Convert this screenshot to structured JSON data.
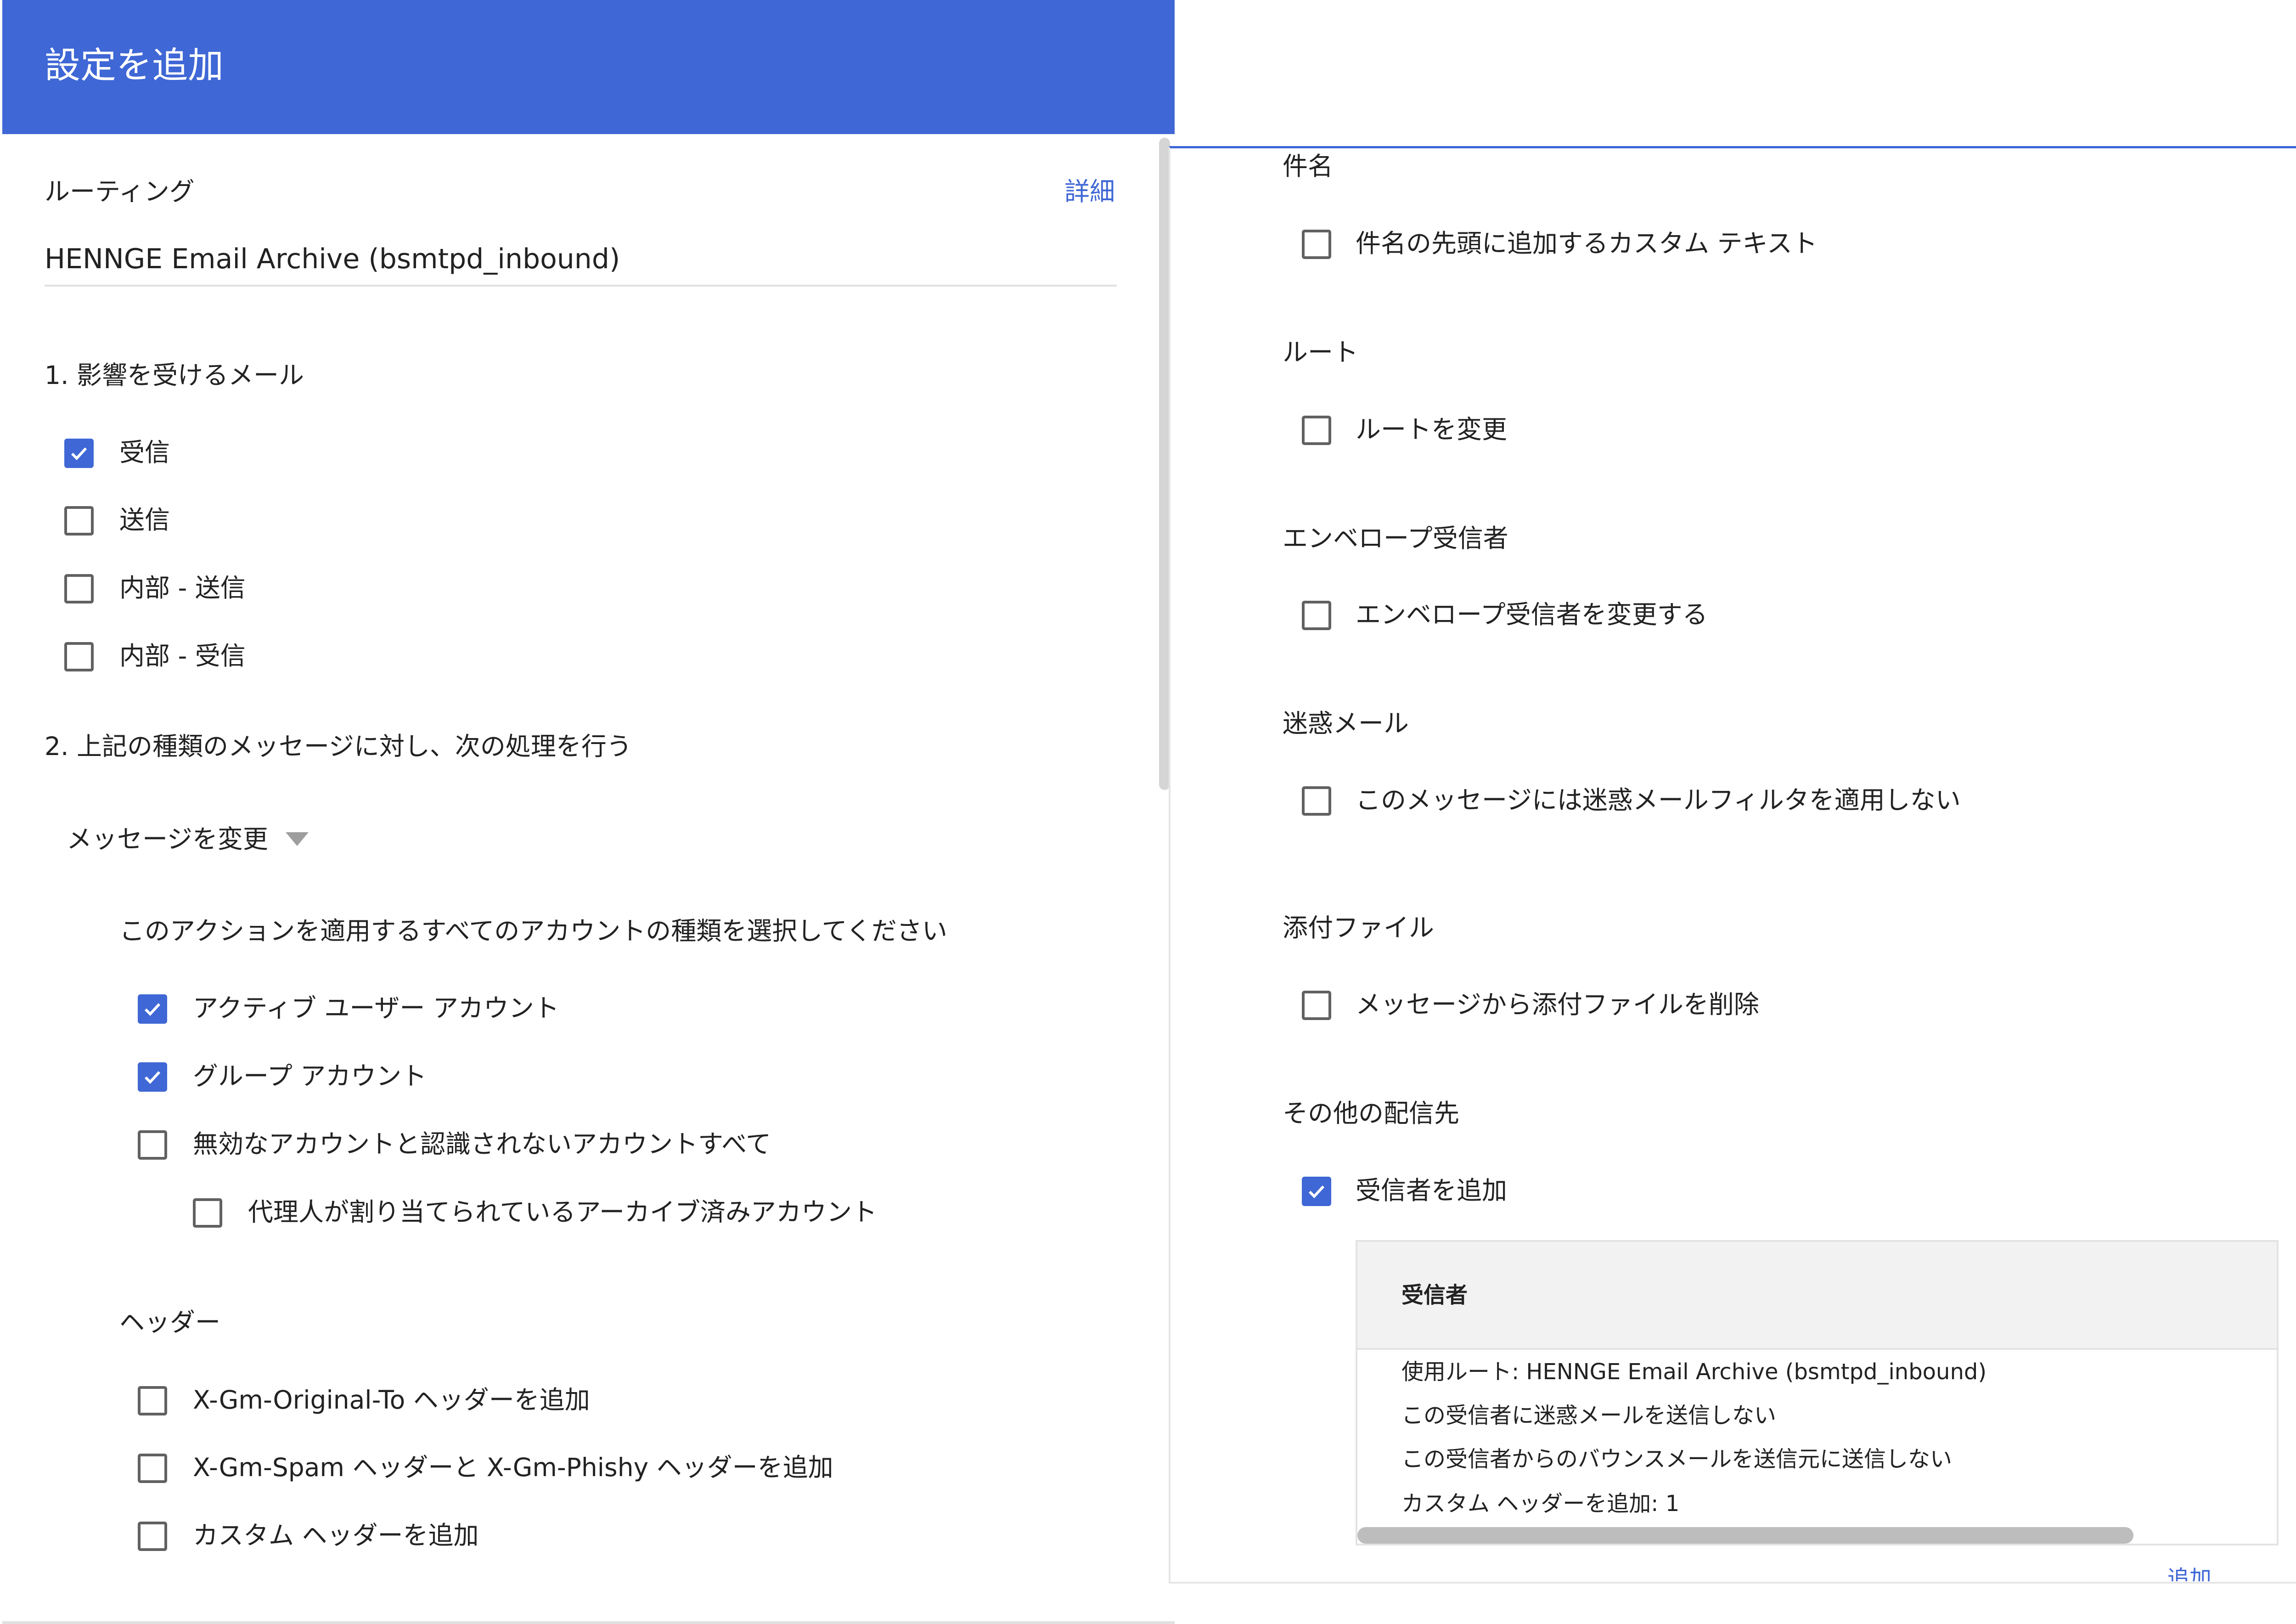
{
  "dialog": {
    "title": "設定を追加"
  },
  "routing": {
    "label": "ルーティング",
    "details_link": "詳細",
    "value": "HENNGE Email Archive (bsmtpd_inbound)"
  },
  "affected": {
    "heading": "1. 影響を受けるメール",
    "options": [
      {
        "label": "受信",
        "checked": true
      },
      {
        "label": "送信",
        "checked": false
      },
      {
        "label": "内部 - 送信",
        "checked": false
      },
      {
        "label": "内部 - 受信",
        "checked": false
      }
    ]
  },
  "action": {
    "heading": "2. 上記の種類のメッセージに対し、次の処理を行う",
    "dropdown_value": "メッセージを変更",
    "account_prompt": "このアクションを適用するすべてのアカウントの種類を選択してください",
    "accounts": [
      {
        "label": "アクティブ ユーザー アカウント",
        "checked": true
      },
      {
        "label": "グループ アカウント",
        "checked": true
      },
      {
        "label": "無効なアカウントと認識されないアカウントすべて",
        "checked": false
      },
      {
        "label": "代理人が割り当てられているアーカイブ済みアカウント",
        "checked": false
      }
    ]
  },
  "headers": {
    "heading": "ヘッダー",
    "options": [
      {
        "label": "X-Gm-Original-To ヘッダーを追加",
        "checked": false
      },
      {
        "label": "X-Gm-Spam ヘッダーと X-Gm-Phishy ヘッダーを追加",
        "checked": false
      },
      {
        "label": "カスタム ヘッダーを追加",
        "checked": false
      }
    ]
  },
  "right": {
    "subject": {
      "heading": "件名",
      "option": "件名の先頭に追加するカスタム テキスト",
      "checked": false
    },
    "route": {
      "heading": "ルート",
      "option": "ルートを変更",
      "checked": false
    },
    "envelope": {
      "heading": "エンベロープ受信者",
      "option": "エンベロープ受信者を変更する",
      "checked": false
    },
    "spam": {
      "heading": "迷惑メール",
      "option": "このメッセージには迷惑メールフィルタを適用しない",
      "checked": false
    },
    "attachments": {
      "heading": "添付ファイル",
      "option": "メッセージから添付ファイルを削除",
      "checked": false
    },
    "other": {
      "heading": "その他の配信先",
      "option": "受信者を追加",
      "checked": true
    },
    "recipients": {
      "column_header": "受信者",
      "lines": [
        "使用ルート: HENNGE Email Archive (bsmtpd_inbound)",
        "この受信者に迷惑メールを送信しない",
        "この受信者からのバウンスメールを送信元に送信しない",
        "カスタム ヘッダーを追加: 1"
      ],
      "add_link": "追加"
    }
  },
  "colors": {
    "accent": "#3f67d5",
    "checkbox_border": "#616161"
  }
}
